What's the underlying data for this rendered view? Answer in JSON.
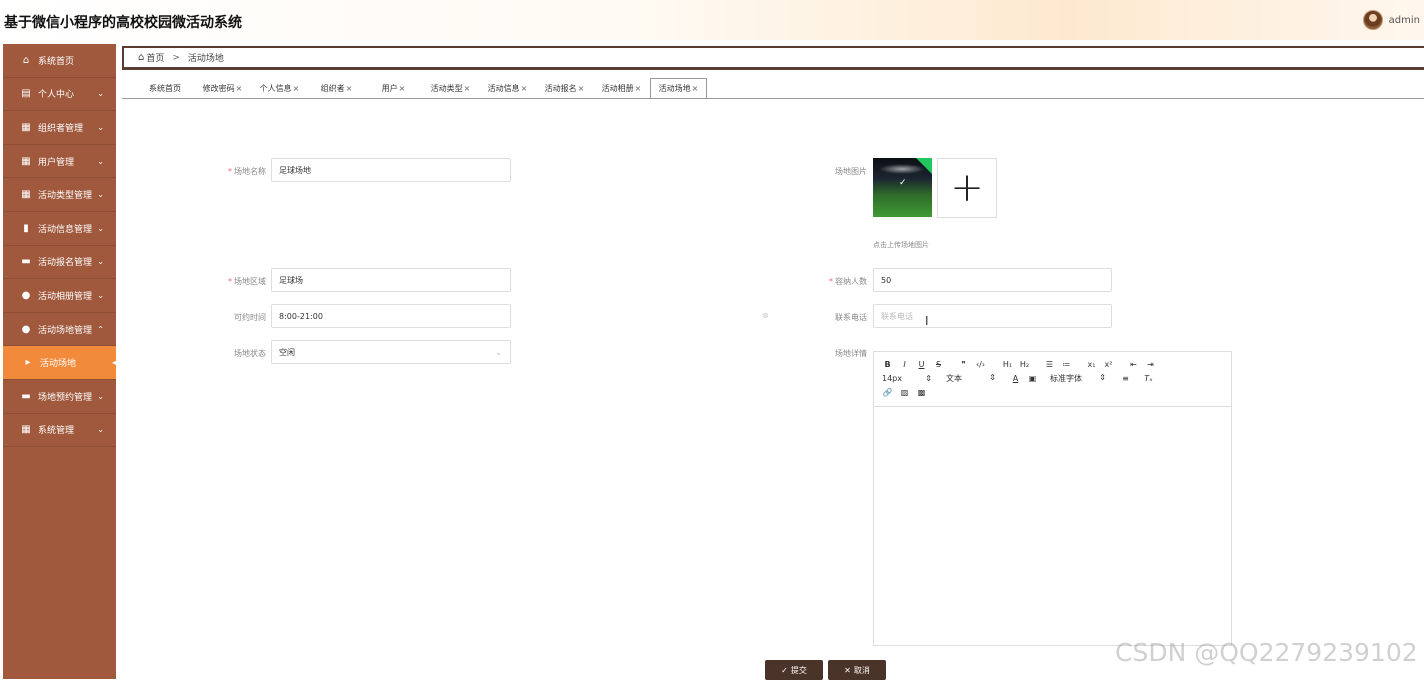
{
  "app": {
    "title": "基于微信小程序的高校校园微活动系统",
    "user": "admin"
  },
  "sidebar": {
    "items": [
      {
        "label": "系统首页",
        "icon": "home-icon",
        "chev": ""
      },
      {
        "label": "个人中心",
        "icon": "id-card-icon",
        "chev": "⌄"
      },
      {
        "label": "组织者管理",
        "icon": "grid-icon",
        "chev": "⌄"
      },
      {
        "label": "用户管理",
        "icon": "grid-icon",
        "chev": "⌄"
      },
      {
        "label": "活动类型管理",
        "icon": "grid-icon",
        "chev": "⌄"
      },
      {
        "label": "活动信息管理",
        "icon": "message-icon",
        "chev": "⌄"
      },
      {
        "label": "活动报名管理",
        "icon": "briefcase-icon",
        "chev": "⌄"
      },
      {
        "label": "活动相册管理",
        "icon": "person-icon",
        "chev": "⌄"
      },
      {
        "label": "活动场地管理",
        "icon": "location-icon",
        "chev": "⌃"
      },
      {
        "label": "活动场地",
        "icon": "caret-right-icon",
        "chev": ""
      },
      {
        "label": "场地预约管理",
        "icon": "ticket-icon",
        "chev": "⌄"
      },
      {
        "label": "系统管理",
        "icon": "grid-icon",
        "chev": "⌄"
      }
    ]
  },
  "breadcrumb": {
    "home": "首页",
    "separator": ">",
    "current": "活动场地"
  },
  "tabs": [
    {
      "label": "系统首页",
      "closable": ""
    },
    {
      "label": "修改密码",
      "closable": "×"
    },
    {
      "label": "个人信息",
      "closable": "×"
    },
    {
      "label": "组织者",
      "closable": "×"
    },
    {
      "label": "用户",
      "closable": "×"
    },
    {
      "label": "活动类型",
      "closable": "×"
    },
    {
      "label": "活动信息",
      "closable": "×"
    },
    {
      "label": "活动报名",
      "closable": "×"
    },
    {
      "label": "活动相册",
      "closable": "×"
    },
    {
      "label": "活动场地",
      "closable": "×"
    }
  ],
  "form": {
    "venue_name": {
      "label": "场地名称",
      "value": "足球场地"
    },
    "venue_image": {
      "label": "场地图片",
      "tip": "点击上传场地图片",
      "plus": "+"
    },
    "venue_area": {
      "label": "场地区域",
      "value": "足球场"
    },
    "capacity": {
      "label": "容纳人数",
      "value": "50"
    },
    "available_time": {
      "label": "可约时间",
      "value": "8:00-21:00"
    },
    "phone": {
      "label": "联系电话",
      "placeholder": "联系电话"
    },
    "status": {
      "label": "场地状态",
      "value": "空闲"
    },
    "details": {
      "label": "场地详情"
    }
  },
  "editor": {
    "font_size": "14px",
    "paragraph": "文本",
    "font_family": "标准字体"
  },
  "actions": {
    "submit": "提交",
    "cancel": "取消"
  },
  "watermark": "CSDN @QQ2279239102"
}
